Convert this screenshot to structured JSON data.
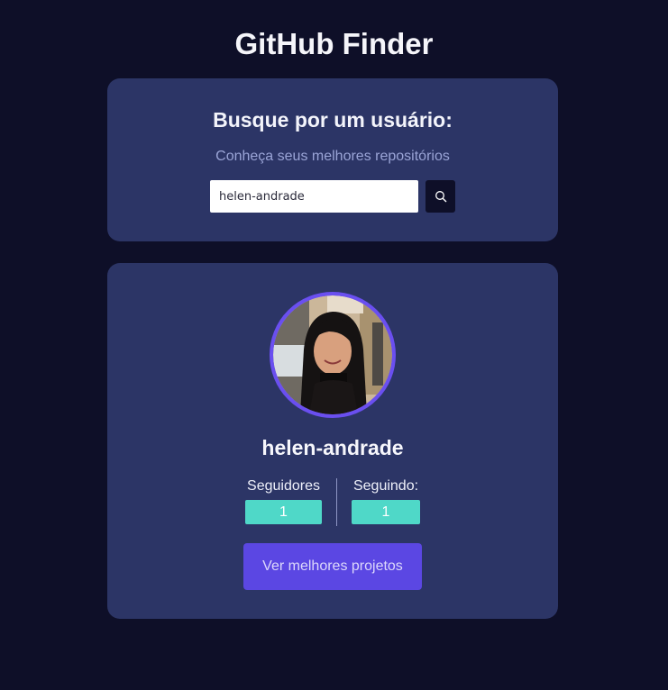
{
  "app": {
    "title": "GitHub Finder"
  },
  "search": {
    "heading": "Busque por um usuário:",
    "subtitle": "Conheça seus melhores repositórios",
    "input_value": "helen-andrade",
    "button_icon": "search-icon"
  },
  "profile": {
    "username": "helen-andrade",
    "followers_label": "Seguidores",
    "followers_value": "1",
    "following_label": "Seguindo:",
    "following_value": "1",
    "projects_button": "Ver melhores projetos"
  },
  "colors": {
    "background": "#0e0f28",
    "card": "#2c3566",
    "accent": "#5b47e3",
    "stat_badge": "#4fd8c8"
  }
}
